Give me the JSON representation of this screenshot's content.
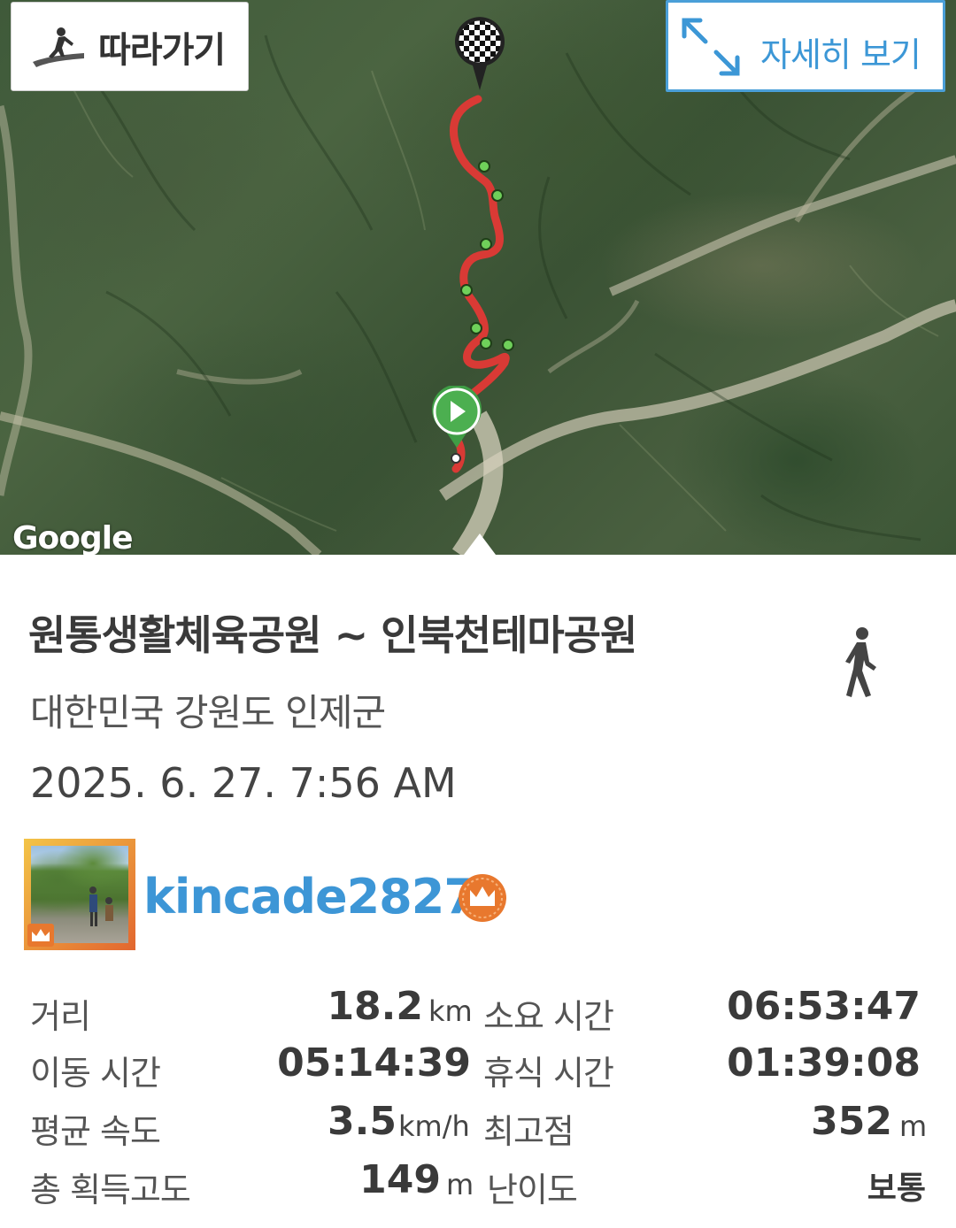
{
  "map": {
    "follow_label": "따라가기",
    "detail_label": "자세히 보기",
    "attribution": "Google"
  },
  "track": {
    "title": "원통생활체육공원 ~ 인북천테마공원",
    "location": "대한민국 강원도 인제군",
    "datetime": "2025. 6. 27. 7:56 AM",
    "activity_icon": "walking-person-icon"
  },
  "user": {
    "name": "kincade2827",
    "badge_icon": "crown-icon"
  },
  "stats": {
    "distance": {
      "label": "거리",
      "value": "18.2",
      "unit": "km"
    },
    "total_time": {
      "label": "소요 시간",
      "value": "06:53:47"
    },
    "moving_time": {
      "label": "이동 시간",
      "value": "05:14:39"
    },
    "rest_time": {
      "label": "휴식 시간",
      "value": "01:39:08"
    },
    "avg_speed": {
      "label": "평균 속도",
      "value": "3.5",
      "unit": "km/h"
    },
    "max_altitude": {
      "label": "최고점",
      "value": "352",
      "unit": "m"
    },
    "elevation_gain": {
      "label": "총 획득고도",
      "value": "149",
      "unit": "m"
    },
    "difficulty": {
      "label": "난이도",
      "value": "보통"
    }
  },
  "colors": {
    "accent_blue": "#3d96d6",
    "route_red": "#d93a35",
    "start_green": "#4caf50",
    "badge_orange": "#e8782e"
  }
}
